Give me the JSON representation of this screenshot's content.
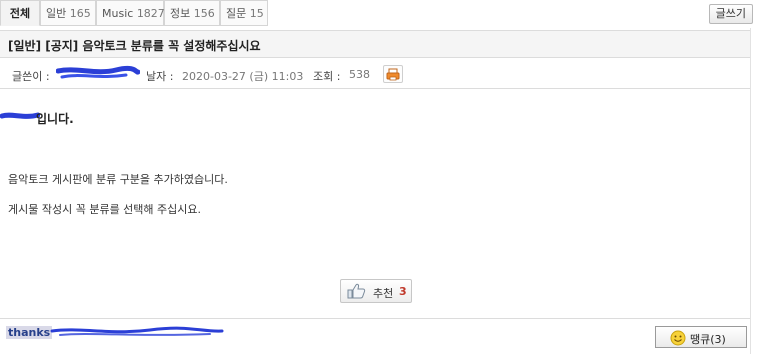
{
  "tabs": [
    {
      "label": "전체",
      "count": "",
      "active": true
    },
    {
      "label": "일반",
      "count": "165",
      "active": false
    },
    {
      "label": "Music",
      "count": "1827",
      "active": false
    },
    {
      "label": "정보",
      "count": "156",
      "active": false
    },
    {
      "label": "질문",
      "count": "15",
      "active": false
    }
  ],
  "toolbar": {
    "write_label": "글쓰기"
  },
  "post": {
    "title": "[일반] [공지] 음악토크 분류를 꼭 설정해주십시요",
    "author_label": "글쓴이 :",
    "date_label": "날자 :",
    "date_value": "2020-03-27 (금) 11:03",
    "views_label": "조회 :",
    "views_value": "538",
    "greeting_suffix": "입니다.",
    "body_lines": [
      "음악토크 게시판에 분류 구분을 추가하였습니다.",
      "게시물 작성시 꼭 분류를 선택해 주십시요."
    ]
  },
  "recommend": {
    "label": "추천",
    "count": "3"
  },
  "thanks": {
    "label": "thanks"
  },
  "luck_button": {
    "label": "땡큐(3)"
  },
  "colors": {
    "redaction": "#2b3fd6",
    "accent_red": "#c0392b",
    "thanks_blue": "#27408b"
  }
}
